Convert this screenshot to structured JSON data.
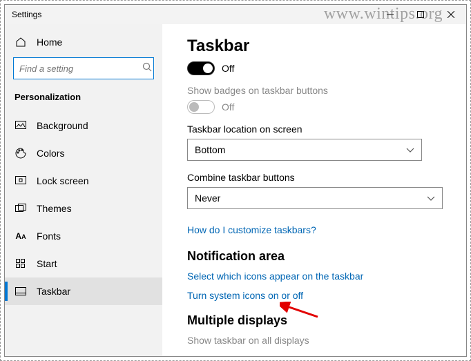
{
  "window": {
    "title": "Settings"
  },
  "watermark": "www.wintips.org",
  "sidebar": {
    "home": "Home",
    "search_placeholder": "Find a setting",
    "section": "Personalization",
    "items": [
      {
        "label": "Background"
      },
      {
        "label": "Colors"
      },
      {
        "label": "Lock screen"
      },
      {
        "label": "Themes"
      },
      {
        "label": "Fonts"
      },
      {
        "label": "Start"
      },
      {
        "label": "Taskbar"
      }
    ]
  },
  "main": {
    "title": "Taskbar",
    "toggle1_state": "Off",
    "badges_label": "Show badges on taskbar buttons",
    "toggle2_state": "Off",
    "location_label": "Taskbar location on screen",
    "location_value": "Bottom",
    "combine_label": "Combine taskbar buttons",
    "combine_value": "Never",
    "customize_link": "How do I customize taskbars?",
    "notif_heading": "Notification area",
    "notif_link1": "Select which icons appear on the taskbar",
    "notif_link2": "Turn system icons on or off",
    "multi_heading": "Multiple displays",
    "multi_label": "Show taskbar on all displays"
  }
}
